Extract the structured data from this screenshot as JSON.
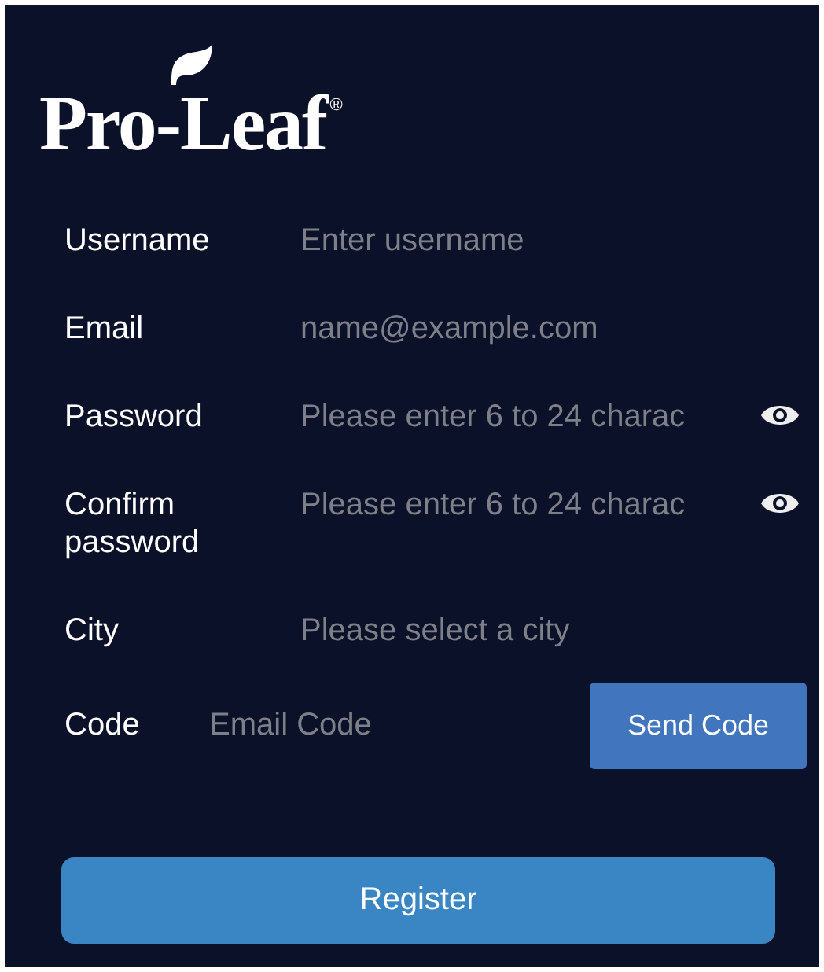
{
  "logo": {
    "text": "Pro-Leaf",
    "mark": "®"
  },
  "fields": [
    {
      "label": "Username",
      "placeholder": "Enter username",
      "kind": "text"
    },
    {
      "label": "Email",
      "placeholder": "name@example.com",
      "kind": "text"
    },
    {
      "label": "Password",
      "placeholder": "Please enter 6 to 24 charac",
      "kind": "password"
    },
    {
      "label": "Confirm password",
      "placeholder": "Please enter 6 to 24 charac",
      "kind": "password"
    },
    {
      "label": "City",
      "placeholder": "Please select a city",
      "kind": "select"
    }
  ],
  "code": {
    "label": "Code",
    "placeholder": "Email Code",
    "button": "Send Code"
  },
  "submit": "Register"
}
